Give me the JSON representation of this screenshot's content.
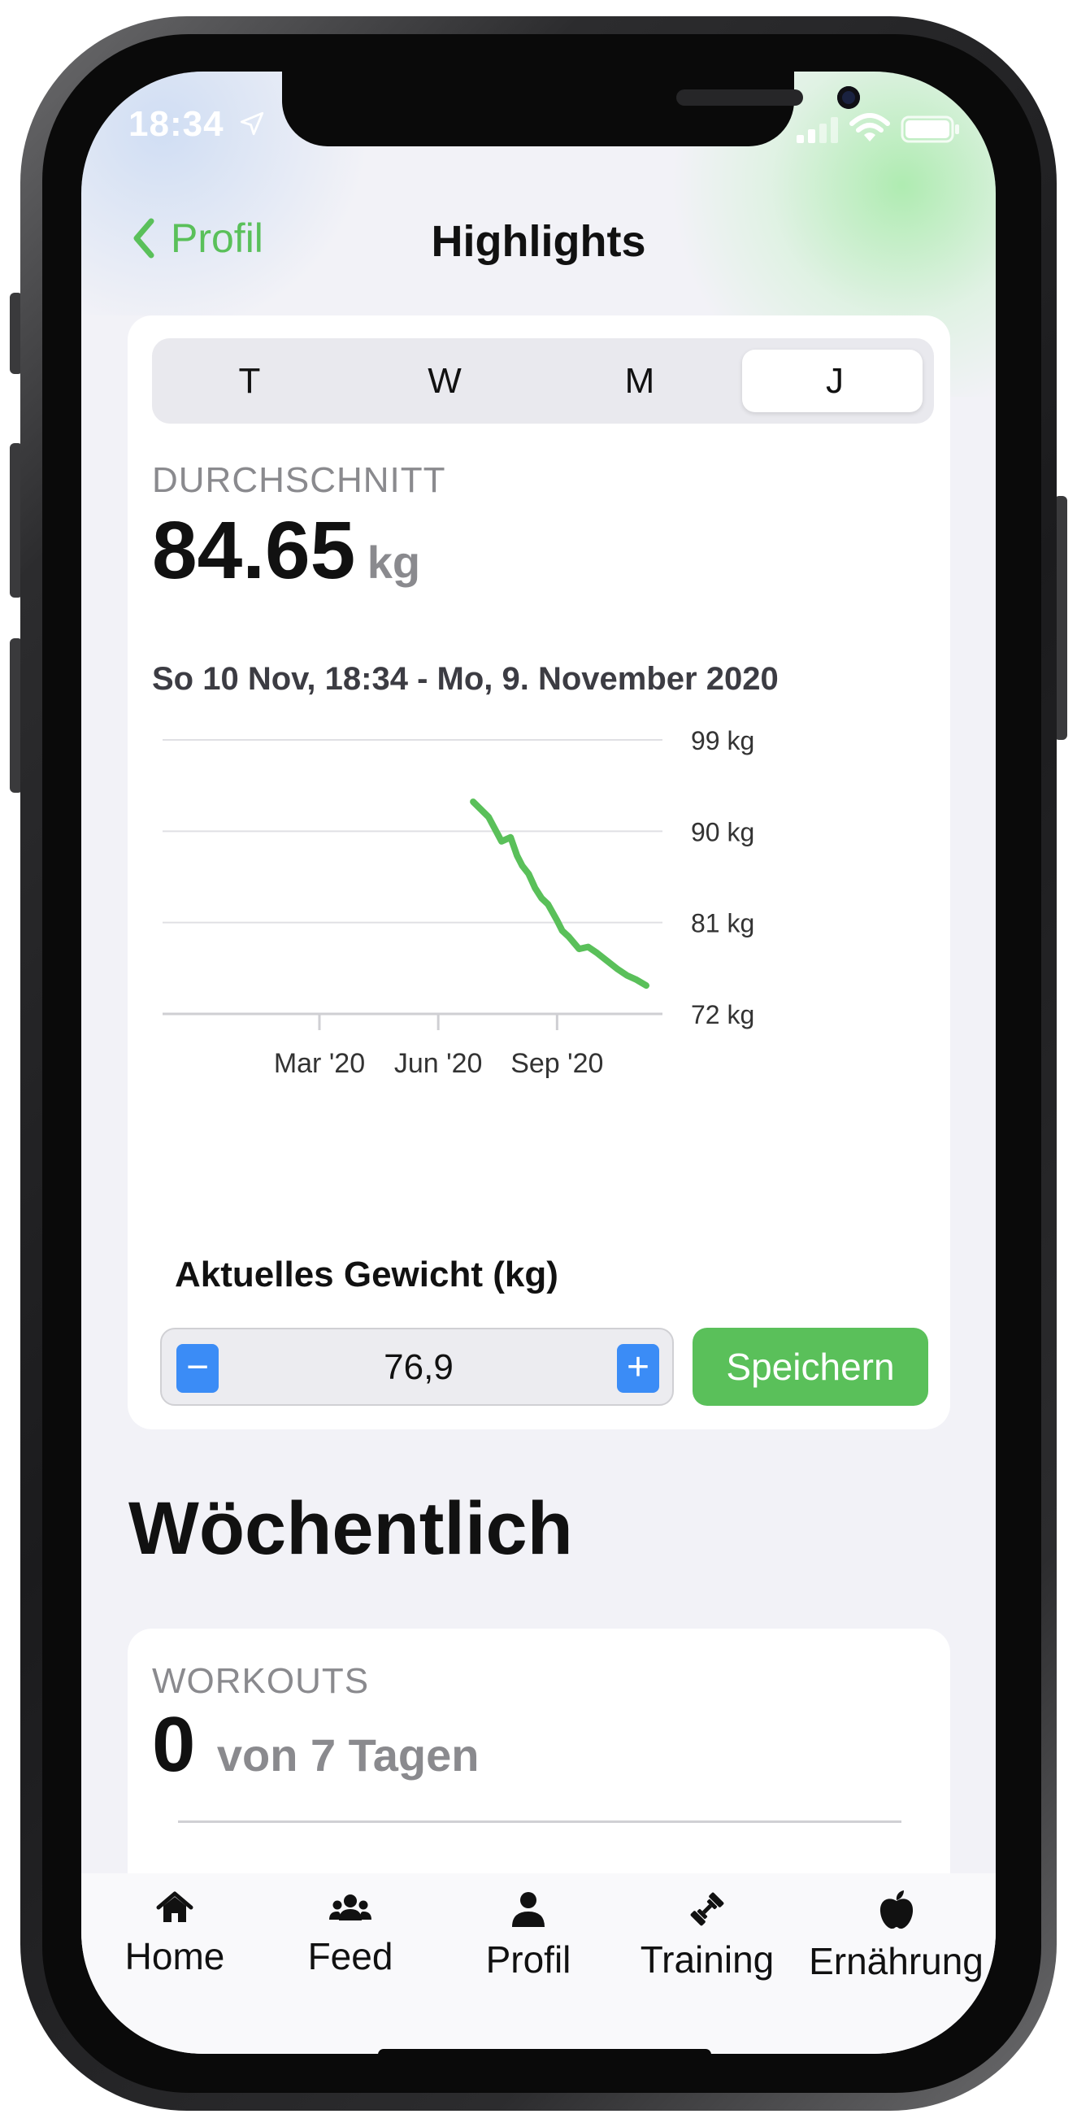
{
  "status": {
    "time": "18:34"
  },
  "nav": {
    "back_label": "Profil",
    "title": "Highlights"
  },
  "segments": {
    "items": [
      "T",
      "W",
      "M",
      "J"
    ],
    "selected": "J"
  },
  "summary": {
    "caption": "DURCHSCHNITT",
    "value": "84.65",
    "unit": "kg",
    "range": "So 10 Nov, 18:34 - Mo, 9. November 2020"
  },
  "chart_data": {
    "type": "line",
    "series": [
      {
        "x": [
          "2020-06-28",
          "2020-07-10",
          "2020-07-20",
          "2020-07-27",
          "2020-08-01",
          "2020-08-05",
          "2020-08-10",
          "2020-08-15",
          "2020-08-20",
          "2020-08-25",
          "2020-09-01",
          "2020-09-05",
          "2020-09-10",
          "2020-09-18",
          "2020-09-25",
          "2020-10-02",
          "2020-10-10",
          "2020-10-18",
          "2020-10-25",
          "2020-11-01",
          "2020-11-09"
        ],
        "values": [
          92.9,
          91.4,
          89.0,
          89.4,
          87.6,
          86.6,
          85.8,
          84.4,
          83.4,
          82.8,
          81.2,
          80.2,
          79.6,
          78.4,
          78.6,
          78.0,
          77.2,
          76.4,
          75.8,
          75.4,
          74.8
        ]
      }
    ],
    "yticks": [
      "99 kg",
      "90 kg",
      "81 kg",
      "72 kg"
    ],
    "ytick_values": [
      99,
      90,
      81,
      72
    ],
    "xticks": [
      "Mar '20",
      "Jun '20",
      "Sep '20"
    ],
    "xtick_dates": [
      "2020-03-01",
      "2020-06-01",
      "2020-09-01"
    ],
    "xlim": [
      "2019-11-10",
      "2020-11-09"
    ],
    "ylim": [
      72,
      99
    ],
    "color": "#5ac05a",
    "grid": true
  },
  "weight_entry": {
    "label": "Aktuelles Gewicht (kg)",
    "value": "76,9",
    "minus": "−",
    "plus": "+",
    "save_label": "Speichern"
  },
  "weekly": {
    "heading": "Wöchentlich",
    "workouts_caption": "WORKOUTS",
    "workouts_count": "0",
    "workouts_suffix": "von 7 Tagen"
  },
  "tabbar": {
    "items": [
      {
        "label": "Home",
        "icon": "house-icon"
      },
      {
        "label": "Feed",
        "icon": "people-icon"
      },
      {
        "label": "Profil",
        "icon": "person-icon"
      },
      {
        "label": "Training",
        "icon": "dumbbell-icon"
      },
      {
        "label": "Ernährung",
        "icon": "apple-icon"
      }
    ]
  },
  "colors": {
    "accent": "#5ac05a",
    "stepper_blue": "#3b8cf6"
  }
}
